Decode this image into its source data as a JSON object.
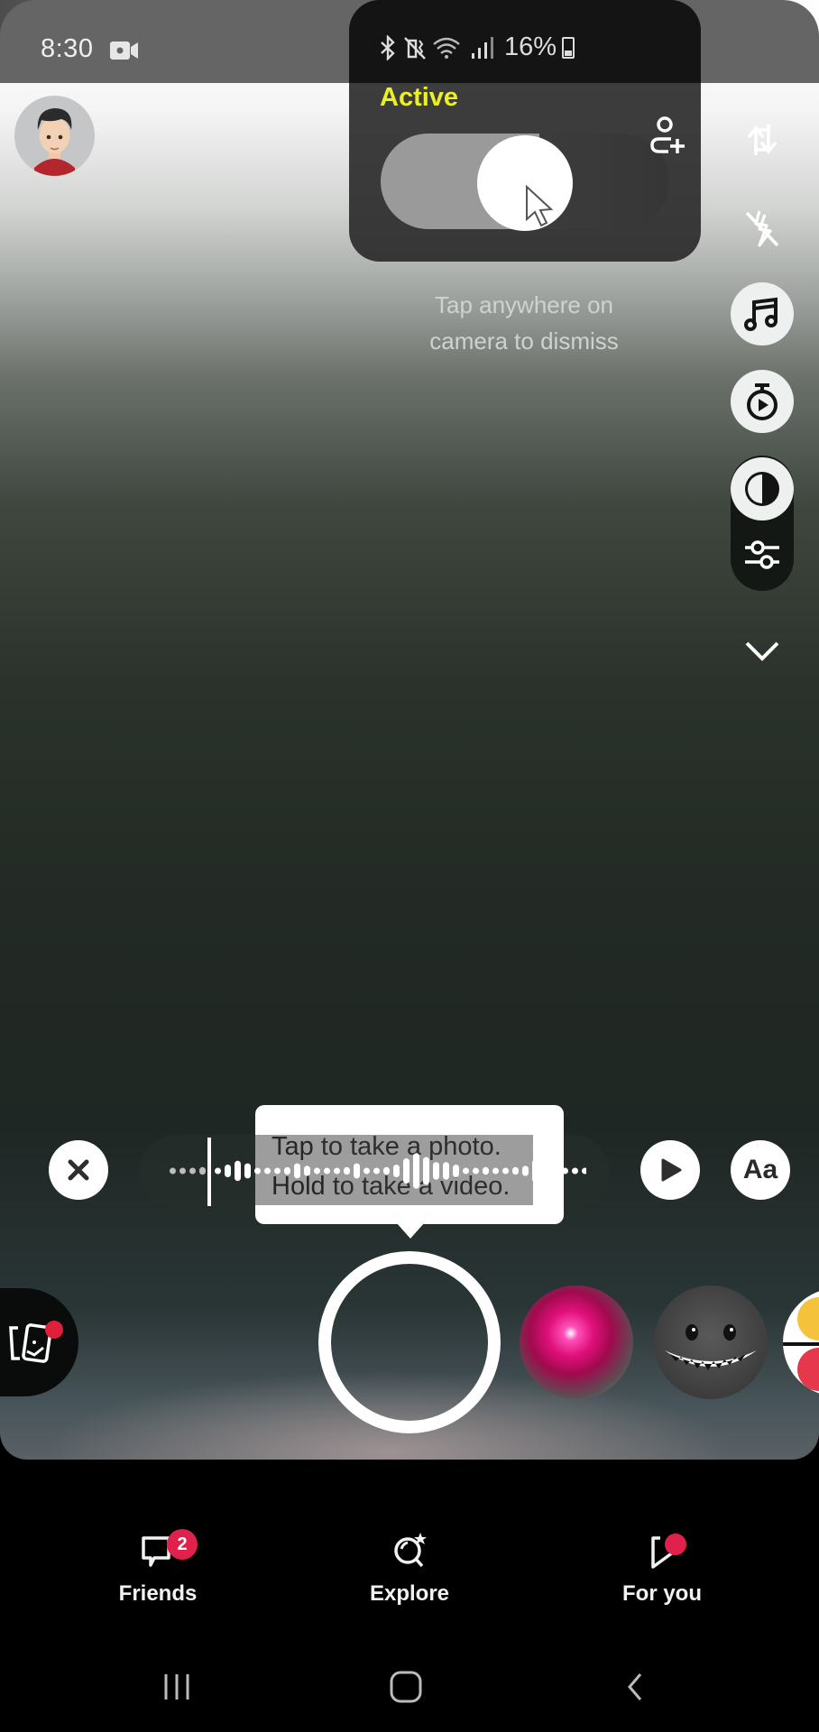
{
  "status_bar": {
    "time": "8:30",
    "battery_percent": "16%",
    "icons": [
      "screen-record-icon",
      "bluetooth-icon",
      "vibrate-mute-icon",
      "wifi-icon",
      "signal-icon",
      "battery-icon"
    ]
  },
  "overlay": {
    "status_label": "Active",
    "toggle_state": "on",
    "dismiss_hint": "Tap anywhere on camera to dismiss"
  },
  "right_rail": {
    "buttons": [
      {
        "name": "flip-camera",
        "icon": "flip-camera-icon"
      },
      {
        "name": "flash-off",
        "icon": "flash-off-icon"
      },
      {
        "name": "music",
        "icon": "music-note-icon"
      },
      {
        "name": "timer",
        "icon": "timer-icon"
      },
      {
        "name": "contrast",
        "icon": "contrast-icon"
      },
      {
        "name": "adjustments",
        "icon": "sliders-icon"
      },
      {
        "name": "more",
        "icon": "chevron-down-icon"
      }
    ]
  },
  "tooltip": {
    "line1_bold": "Tap",
    "line1_rest": " to take a photo.",
    "line2_bold": "Hold",
    "line2_rest": " to take a video."
  },
  "audio_controls": {
    "close_icon": "close-icon",
    "play_icon": "play-icon",
    "text_label": "Aa"
  },
  "lenses": [
    {
      "name": "pink-glow-lens"
    },
    {
      "name": "grin-monster-lens"
    },
    {
      "name": "emoji-lens"
    }
  ],
  "bottom_nav": {
    "items": [
      {
        "label": "Friends",
        "icon": "chat-icon",
        "badge": "2"
      },
      {
        "label": "Explore",
        "icon": "explore-icon"
      },
      {
        "label": "For you",
        "icon": "spotlight-play-icon",
        "dot": true
      }
    ]
  },
  "colors": {
    "active_yellow": "#ecf022",
    "badge_red": "#e0214b"
  }
}
